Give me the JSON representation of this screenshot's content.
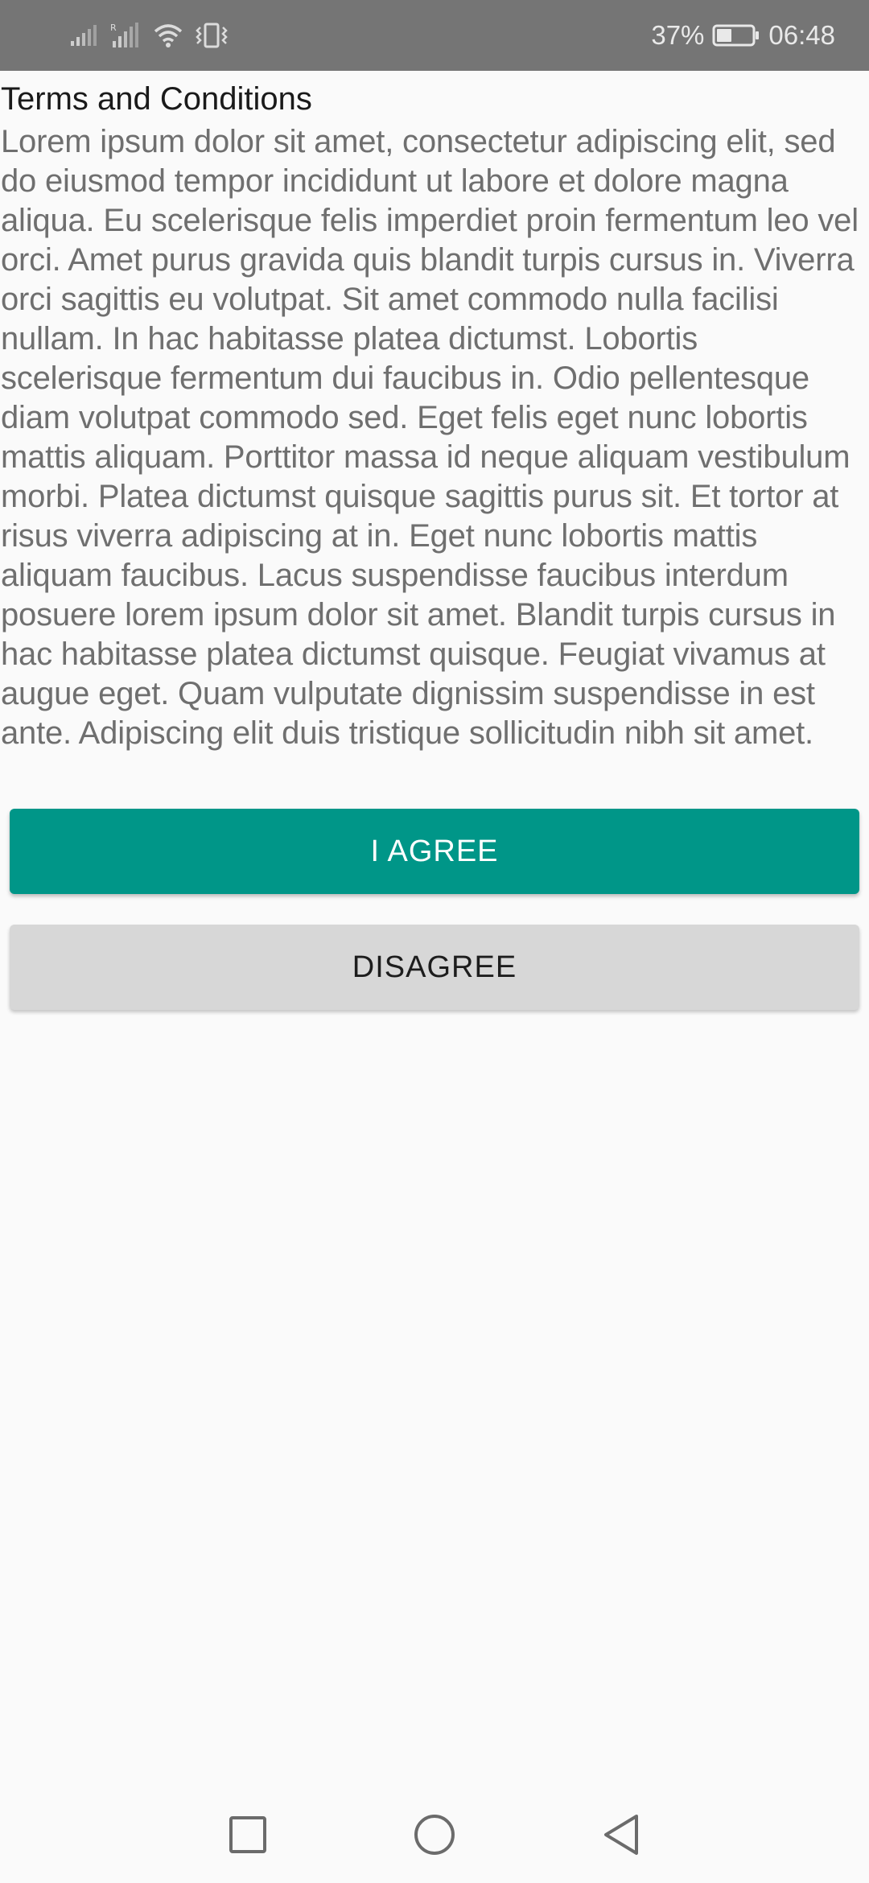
{
  "status_bar": {
    "battery_percent": "37%",
    "time": "06:48",
    "icons": [
      "signal-icon",
      "signal-roaming-icon",
      "wifi-icon",
      "vibrate-icon",
      "battery-icon"
    ]
  },
  "terms": {
    "title": "Terms and Conditions",
    "body": "Lorem ipsum dolor sit amet, consectetur adipiscing elit, sed do eiusmod tempor incididunt ut labore et dolore magna aliqua. Eu scelerisque felis imperdiet proin fermentum leo vel orci. Amet purus gravida quis blandit turpis cursus in. Viverra orci sagittis eu volutpat. Sit amet commodo nulla facilisi nullam. In hac habitasse platea dictumst. Lobortis scelerisque fermentum dui faucibus in. Odio pellentesque diam volutpat commodo sed. Eget felis eget nunc lobortis mattis aliquam. Porttitor massa id neque aliquam vestibulum morbi. Platea dictumst quisque sagittis purus sit. Et tortor at risus viverra adipiscing at in. Eget nunc lobortis mattis aliquam faucibus. Lacus suspendisse faucibus interdum posuere lorem ipsum dolor sit amet. Blandit turpis cursus in hac habitasse platea dictumst quisque. Feugiat vivamus at augue eget. Quam vulputate dignissim suspendisse in est ante. Adipiscing elit duis tristique sollicitudin nibh sit amet."
  },
  "actions": {
    "agree_label": "I AGREE",
    "disagree_label": "DISAGREE"
  },
  "colors": {
    "status_bar_bg": "#757575",
    "agree_bg": "#009688",
    "disagree_bg": "#d7d7d7",
    "body_text": "#6f6f6f"
  },
  "nav_bar": {
    "icons": [
      "recents-icon",
      "home-icon",
      "back-icon"
    ]
  }
}
